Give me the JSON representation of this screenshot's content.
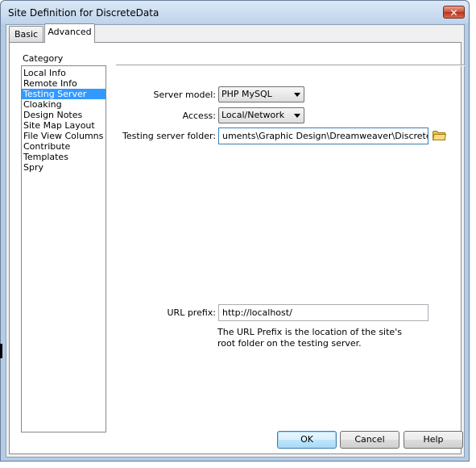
{
  "window": {
    "title": "Site Definition for DiscreteData",
    "close_label": "✕"
  },
  "tabs": [
    {
      "label": "Basic",
      "active": false
    },
    {
      "label": "Advanced",
      "active": true
    }
  ],
  "category": {
    "label": "Category",
    "items": [
      {
        "label": "Local Info",
        "selected": false
      },
      {
        "label": "Remote Info",
        "selected": false
      },
      {
        "label": "Testing Server",
        "selected": true
      },
      {
        "label": "Cloaking",
        "selected": false
      },
      {
        "label": "Design Notes",
        "selected": false
      },
      {
        "label": "Site Map Layout",
        "selected": false
      },
      {
        "label": "File View Columns",
        "selected": false
      },
      {
        "label": "Contribute",
        "selected": false
      },
      {
        "label": "Templates",
        "selected": false
      },
      {
        "label": "Spry",
        "selected": false
      }
    ]
  },
  "form": {
    "server_model_label": "Server model:",
    "server_model_value": "PHP MySQL",
    "access_label": "Access:",
    "access_value": "Local/Network",
    "testing_folder_label": "Testing server folder:",
    "testing_folder_value": "uments\\Graphic Design\\Dreamweaver\\DiscreteData\\",
    "url_prefix_label": "URL prefix:",
    "url_prefix_value": "http://localhost/",
    "help_line1": "The URL Prefix is the location of the site's",
    "help_line2": "root folder on the testing server."
  },
  "buttons": {
    "ok": "OK",
    "cancel": "Cancel",
    "help": "Help"
  },
  "colors": {
    "selection": "#3399ff",
    "folder": "#e8c14a"
  },
  "icons": {
    "browse_folder": "folder-icon"
  }
}
